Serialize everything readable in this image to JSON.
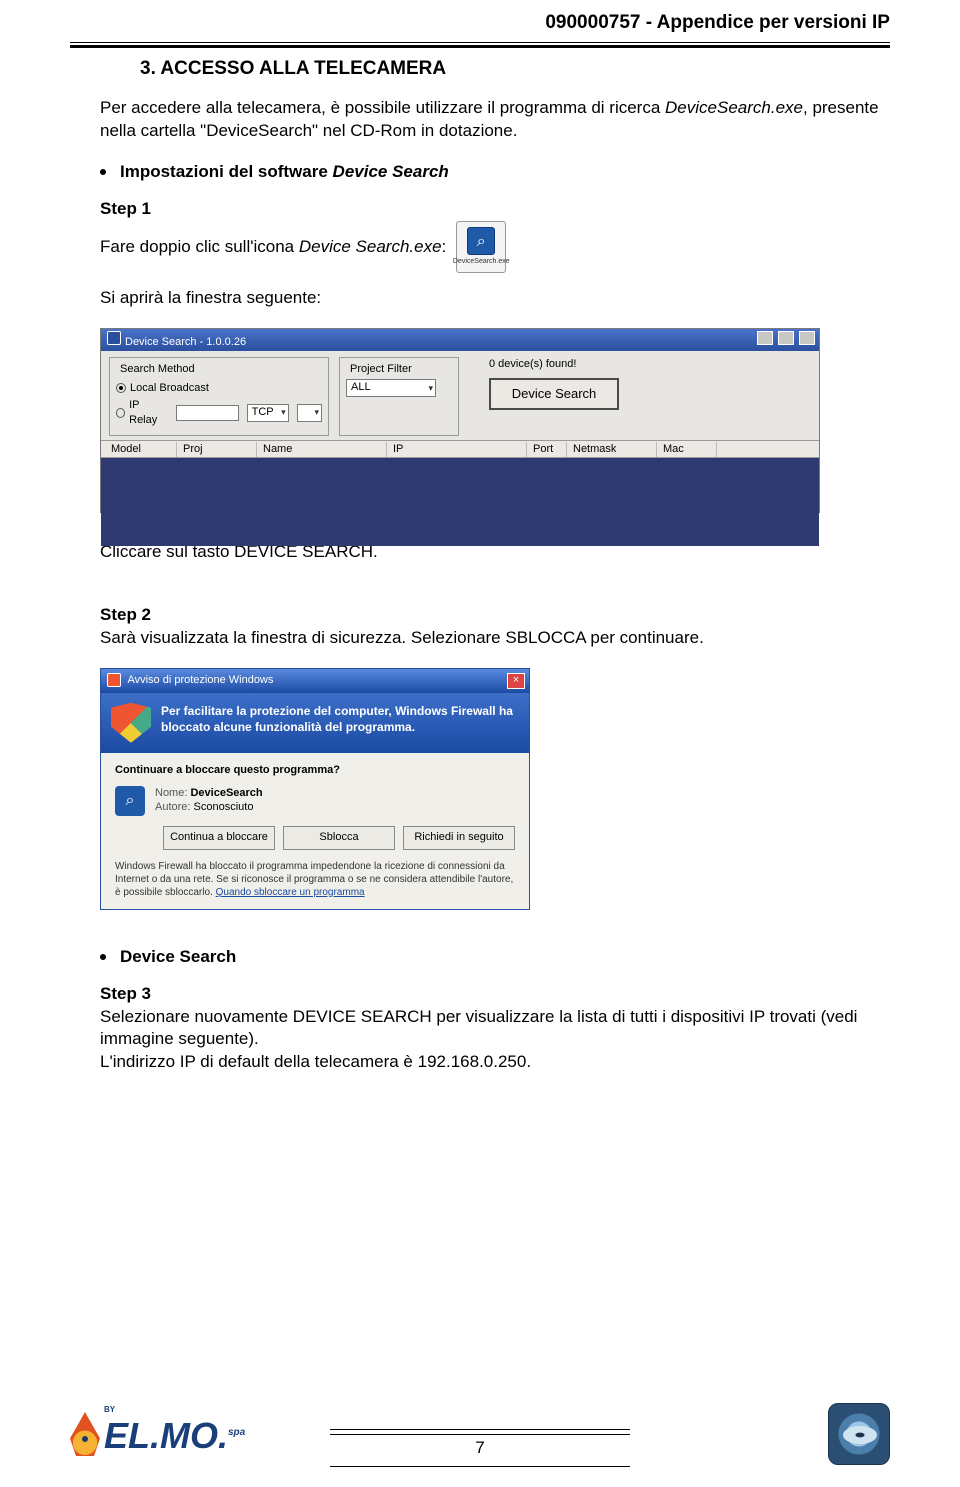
{
  "header_id": "090000757  -  Appendice per versioni IP",
  "section_title": "3. ACCESSO ALLA TELECAMERA",
  "intro_1a": "Per accedere alla telecamera, è possibile utilizzare il programma di ricerca ",
  "intro_1b": "DeviceSearch.exe",
  "intro_1c": ", presente nella cartella \"DeviceSearch\" nel CD-Rom in dotazione.",
  "bullet1_label": "Impostazioni del software ",
  "bullet1_ital": "Device Search",
  "step1_label": "Step 1",
  "step1_text_a": "Fare doppio clic sull'icona ",
  "step1_text_b": "Device Search.exe",
  "step1_text_c": ":",
  "exe_caption": "DeviceSearch.exe",
  "after_icon": "Si aprirà la finestra seguente:",
  "ds_window": {
    "title": "Device Search - 1.0.0.26",
    "search_method_legend": "Search Method",
    "radio_local": "Local Broadcast",
    "radio_iprelay": "IP Relay",
    "tcp": "TCP",
    "project_filter_legend": "Project Filter",
    "filter_value": "ALL",
    "found_text": "0 device(s) found!",
    "button": "Device Search",
    "cols": {
      "model": "Model",
      "proj": "Proj",
      "name": "Name",
      "ip": "IP",
      "port": "Port",
      "netmask": "Netmask",
      "mac": "Mac"
    }
  },
  "click_ds": "Cliccare sul tasto DEVICE SEARCH.",
  "step2_label": "Step 2",
  "step2_text": "Sarà visualizzata la finestra di sicurezza. Selezionare SBLOCCA per continuare.",
  "fw": {
    "title": "Avviso di protezione Windows",
    "alert": "Per facilitare la protezione del computer, Windows Firewall ha bloccato alcune funzionalità del programma.",
    "question": "Continuare a bloccare questo programma?",
    "name_lbl": "Nome:",
    "name_val": "DeviceSearch",
    "author_lbl": "Autore:",
    "author_val": "Sconosciuto",
    "btn_block": "Continua a bloccare",
    "btn_unblock": "Sblocca",
    "btn_later": "Richiedi in seguito",
    "note_a": "Windows Firewall ha bloccato il programma impedendone la ricezione di connessioni da Internet o da una rete. Se si riconosce il programma o se ne considera attendibile l'autore, è possibile sbloccarlo. ",
    "note_link": "Quando sbloccare un programma"
  },
  "bullet2_label": "Device Search",
  "step3_label": "Step 3",
  "step3_text": "Selezionare nuovamente DEVICE SEARCH per visualizzare la lista di tutti i dispositivi IP trovati (vedi immagine seguente).",
  "step3_line2": "L'indirizzo IP di default della telecamera è 192.168.0.250.",
  "page_number": "7",
  "logo_by": "BY",
  "logo_text": "EL.MO.",
  "logo_spa": "spa"
}
